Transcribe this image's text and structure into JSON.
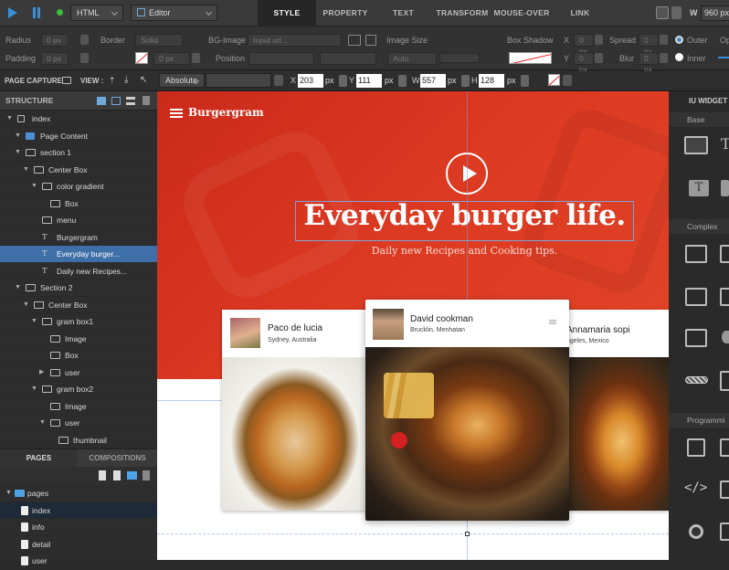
{
  "toolbar": {
    "doc_type": "HTML",
    "mode": "Editor",
    "tabs": [
      "STYLE",
      "PROPERTY",
      "TEXT",
      "TRANSFORM",
      "MOUSE-OVER",
      "LINK"
    ],
    "width_label": "W",
    "width_value": "960 px"
  },
  "style_bar": {
    "radius_label": "Radius",
    "radius_value": "0 px",
    "padding_label": "Padding",
    "border_label": "Border",
    "border_style": "Solid",
    "border_width": "0 px",
    "bg_image_label": "BG-Image",
    "bg_image_placeholder": "Input url...",
    "position_label": "Position",
    "image_size_label": "Image Size",
    "image_size_value": "Auto",
    "box_shadow_label": "Box Shadow",
    "x_label": "X",
    "y_label": "Y",
    "x_value": "0 px",
    "y_value": "0 px",
    "spread_label": "Spread",
    "spread_value": "0 px",
    "blur_label": "Blur",
    "blur_value": "0 px",
    "outer_label": "Outer",
    "inner_label": "Inner",
    "op_label": "Op"
  },
  "view_bar": {
    "page_capture": "PAGE CAPTURE",
    "view_label": "VIEW :",
    "position_mode": "Absolute",
    "x_label": "X",
    "x_value": "203",
    "y_label": "Y",
    "y_value": "111",
    "w_label": "W",
    "w_value": "557",
    "h_label": "H",
    "h_value": "128",
    "unit": "px"
  },
  "structure": {
    "title": "STRUCTURE",
    "items": [
      {
        "label": "index",
        "type": "page"
      },
      {
        "label": "Page Content",
        "type": "content"
      },
      {
        "label": "section 1",
        "type": "section"
      },
      {
        "label": "Center Box",
        "type": "centerbox"
      },
      {
        "label": "color gradient",
        "type": "box"
      },
      {
        "label": "Box",
        "type": "box"
      },
      {
        "label": "menu",
        "type": "menu"
      },
      {
        "label": "Burgergram",
        "type": "text"
      },
      {
        "label": "Everyday burger...",
        "type": "text"
      },
      {
        "label": "Daily new Recipes...",
        "type": "text"
      },
      {
        "label": "Section 2",
        "type": "section"
      },
      {
        "label": "Center Box",
        "type": "centerbox"
      },
      {
        "label": "gram box1",
        "type": "box"
      },
      {
        "label": "Image",
        "type": "image"
      },
      {
        "label": "Box",
        "type": "box"
      },
      {
        "label": "user",
        "type": "box"
      },
      {
        "label": "gram box2",
        "type": "box"
      },
      {
        "label": "Image",
        "type": "image"
      },
      {
        "label": "user",
        "type": "box"
      },
      {
        "label": "thumbnail",
        "type": "box"
      }
    ]
  },
  "pages_panel": {
    "tab_pages": "PAGES",
    "tab_compositions": "COMPOSITIONS",
    "items": [
      "pages",
      "index",
      "info",
      "detail",
      "user"
    ]
  },
  "site": {
    "brand": "Burgergram",
    "headline": "Everyday burger life.",
    "subtitle": "Daily new Recipes and Cooking tips.",
    "cards": [
      {
        "name": "Paco de lucia",
        "location": "Sydney, Australia"
      },
      {
        "name": "David cookman",
        "location": "Brucklin, Menhatan"
      },
      {
        "name": "Annamaria sopi",
        "location": "ngeles, Mexico"
      }
    ]
  },
  "widgets": {
    "title": "IU WIDGET",
    "sections": [
      "Base",
      "Complex",
      "Programmi"
    ]
  },
  "colors": {
    "hero": "#d9341f",
    "selected": "#3f6fa8",
    "canvas_bg": "#ffffff"
  }
}
